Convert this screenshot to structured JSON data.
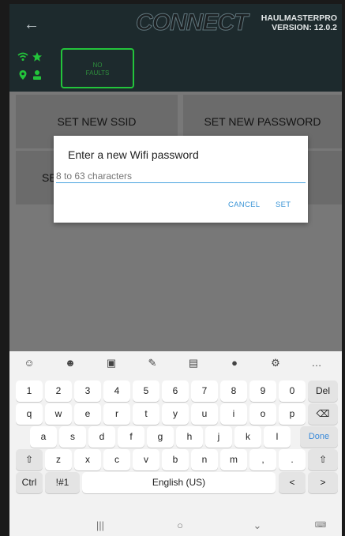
{
  "header": {
    "logo": "CONNECT",
    "version_line1": "HAULMASTERPRO",
    "version_line2": "VERSION: 12.0.2"
  },
  "status": {
    "fault_line1": "NO",
    "fault_line2": "FAULTS"
  },
  "menu": {
    "set_ssid": "SET NEW SSID",
    "set_password": "SET NEW PASSWORD",
    "partial_label": "SE"
  },
  "dialog": {
    "title": "Enter a new Wifi password",
    "placeholder": "8 to 63 characters",
    "cancel": "CANCEL",
    "set": "SET"
  },
  "keyboard": {
    "row1": [
      "1",
      "2",
      "3",
      "4",
      "5",
      "6",
      "7",
      "8",
      "9",
      "0"
    ],
    "row1_end": "Del",
    "row2": [
      "q",
      "w",
      "e",
      "r",
      "t",
      "y",
      "u",
      "i",
      "o",
      "p"
    ],
    "row3": [
      "a",
      "s",
      "d",
      "f",
      "g",
      "h",
      "j",
      "k",
      "l"
    ],
    "row3_end": "Done",
    "row4": [
      "z",
      "x",
      "c",
      "v",
      "b",
      "n",
      "m",
      ",",
      "."
    ],
    "ctrl": "Ctrl",
    "symbols": "!#1",
    "space": "English (US)",
    "toolbar_icons": [
      "emoji-icon",
      "sticker-icon",
      "gif-icon",
      "handwriting-icon",
      "clipboard-icon",
      "mic-icon",
      "settings-icon",
      "more-icon"
    ]
  },
  "colors": {
    "header_bg": "#1d2a2d",
    "fault_border": "#23c43b",
    "accent": "#3b95d6"
  }
}
